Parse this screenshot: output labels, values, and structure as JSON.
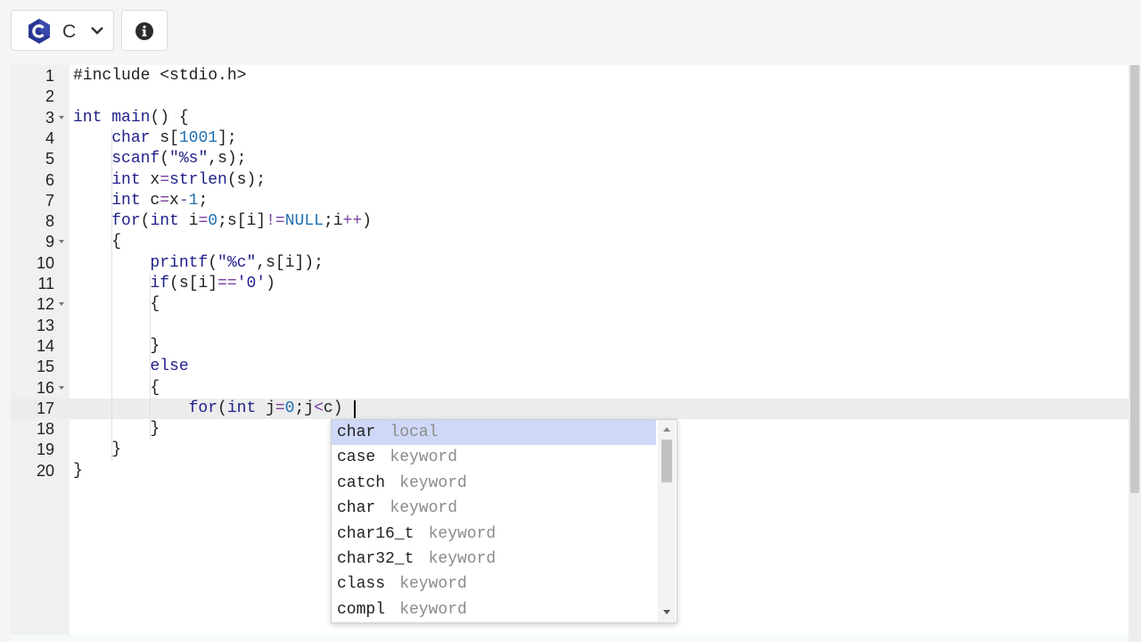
{
  "toolbar": {
    "language_label": "C",
    "language_logo_icon": "c-language-logo-icon",
    "language_dropdown_icon": "chevron-down-icon",
    "info_icon": "info-icon"
  },
  "colors": {
    "logo_blue": "#283593",
    "selection": "#cfd8f7",
    "active_line": "#ececec"
  },
  "editor": {
    "active_line": 17,
    "lines": [
      {
        "n": "1"
      },
      {
        "n": "2"
      },
      {
        "n": "3",
        "fold": true
      },
      {
        "n": "4"
      },
      {
        "n": "5"
      },
      {
        "n": "6"
      },
      {
        "n": "7"
      },
      {
        "n": "8"
      },
      {
        "n": "9",
        "fold": true
      },
      {
        "n": "10"
      },
      {
        "n": "11"
      },
      {
        "n": "12",
        "fold": true
      },
      {
        "n": "13"
      },
      {
        "n": "14"
      },
      {
        "n": "15"
      },
      {
        "n": "16",
        "fold": true
      },
      {
        "n": "17"
      },
      {
        "n": "18"
      },
      {
        "n": "19"
      },
      {
        "n": "20"
      }
    ],
    "code": [
      "#include <stdio.h>",
      "",
      "int main() {",
      "    char s[1001];",
      "    scanf(\"%s\",s);",
      "    int x=strlen(s);",
      "    int c=x-1;",
      "    for(int i=0;s[i]!=NULL;i++)",
      "    {",
      "        printf(\"%c\",s[i]);",
      "        if(s[i]=='0')",
      "        {",
      "",
      "        }",
      "        else",
      "        {",
      "            for(int j=0;j<c)",
      "        }",
      "    }",
      "}"
    ]
  },
  "autocomplete": {
    "items": [
      {
        "name": "char",
        "meta": "local",
        "selected": true
      },
      {
        "name": "case",
        "meta": "keyword"
      },
      {
        "name": "catch",
        "meta": "keyword"
      },
      {
        "name": "char",
        "meta": "keyword"
      },
      {
        "name": "char16_t",
        "meta": "keyword"
      },
      {
        "name": "char32_t",
        "meta": "keyword"
      },
      {
        "name": "class",
        "meta": "keyword"
      },
      {
        "name": "compl",
        "meta": "keyword"
      }
    ]
  }
}
